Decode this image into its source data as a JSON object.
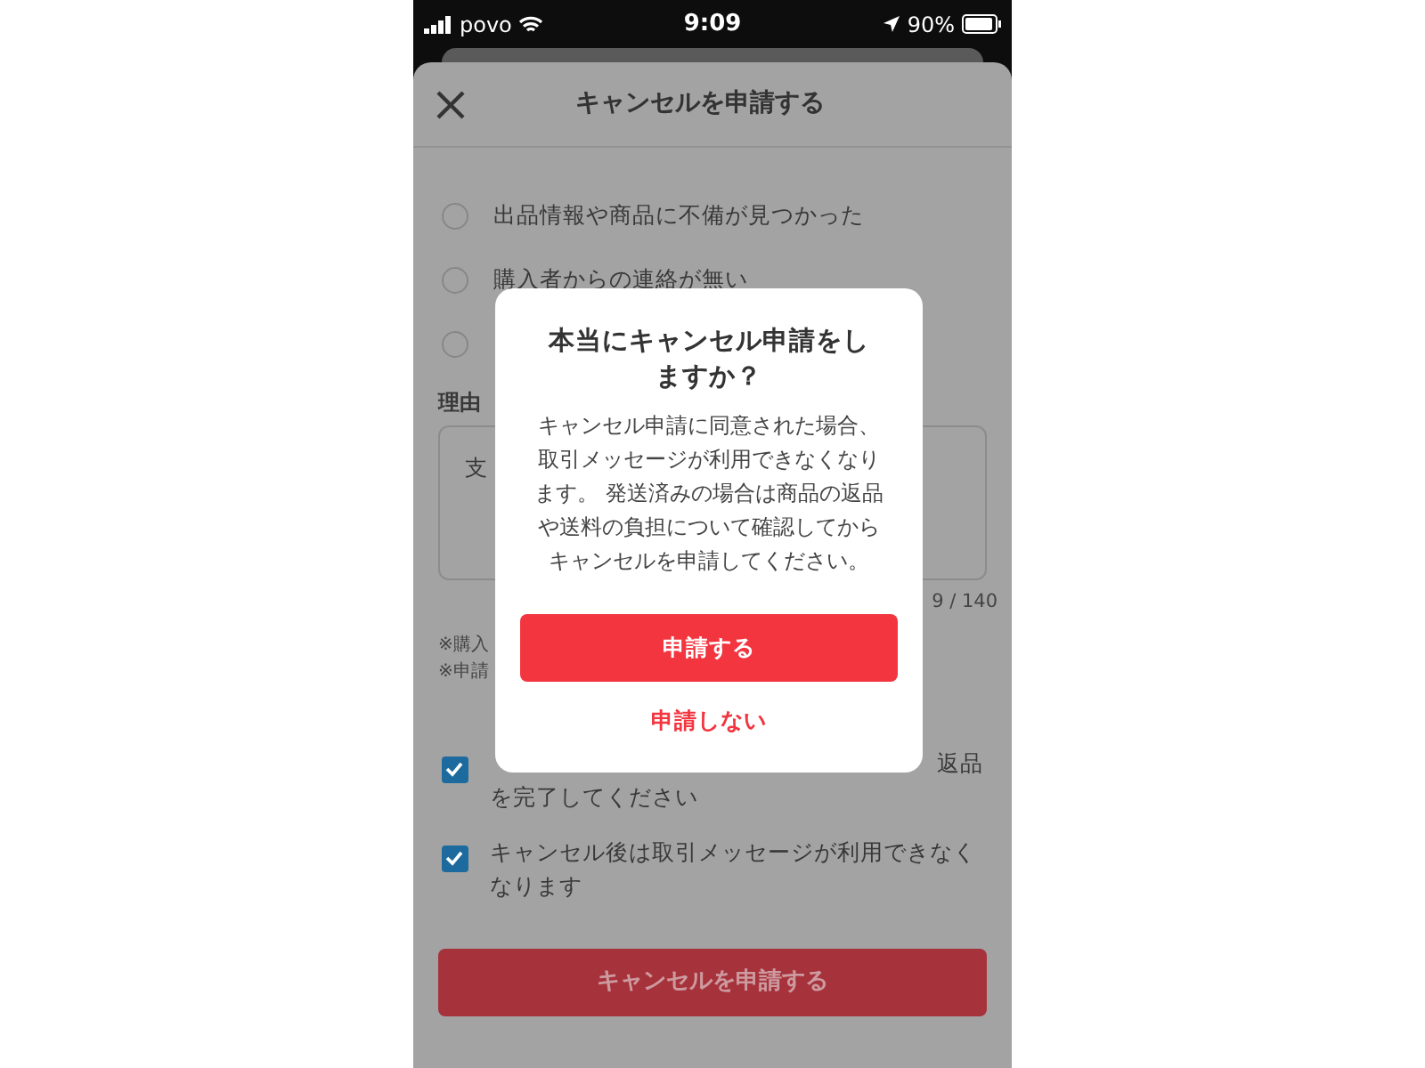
{
  "status_bar": {
    "carrier": "povo",
    "time": "9:09",
    "battery": "90%"
  },
  "sheet": {
    "title": "キャンセルを申請する",
    "reasons": [
      {
        "label": "出品情報や商品に不備が見つかった",
        "selected": false
      },
      {
        "label": "購入者からの連絡が無い",
        "selected": false
      },
      {
        "selected": false
      }
    ],
    "reason_label": "理由",
    "reason_text": "支",
    "counter": "9 / 140",
    "notes": [
      "※購入",
      "※申請"
    ],
    "confirmations": [
      {
        "label_end": "返品",
        "label_line2": "を完了してください",
        "checked": true
      },
      {
        "label": "キャンセル後は取引メッセージが利用できなくなります",
        "checked": true
      }
    ],
    "submit": "キャンセルを申請する"
  },
  "dialog": {
    "title": "本当にキャンセル申請をしますか？",
    "message": "キャンセル申請に同意された場合、取引メッセージが利用できなくなります。 発送済みの場合は商品の返品や送料の負担について確認してからキャンセルを申請してください。",
    "confirm": "申請する",
    "cancel": "申請しない"
  }
}
